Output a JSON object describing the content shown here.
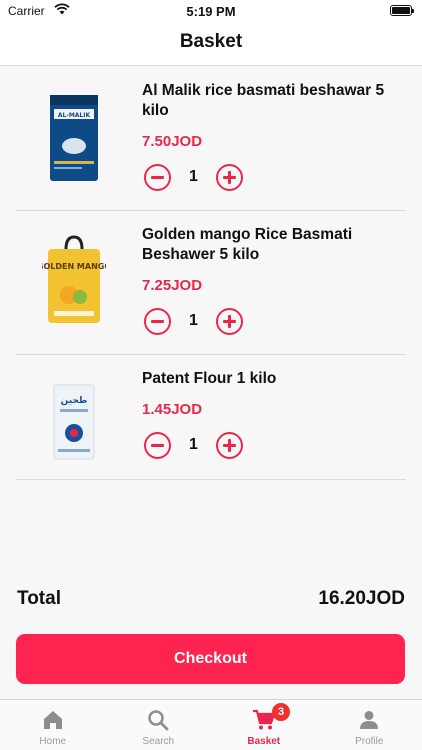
{
  "status_bar": {
    "carrier": "Carrier",
    "time": "5:19 PM"
  },
  "header": {
    "title": "Basket"
  },
  "items": [
    {
      "name": "Al Malik rice basmati beshawar 5 kilo",
      "price": "7.50JOD",
      "quantity": "1",
      "logo_text": "AL-MALIK"
    },
    {
      "name": "Golden mango Rice Basmati Beshawer 5 kilo",
      "price": "7.25JOD",
      "quantity": "1",
      "logo_text": "GOLDEN MANGO"
    },
    {
      "name": "Patent Flour 1 kilo",
      "price": "1.45JOD",
      "quantity": "1",
      "logo_text": "طحين"
    }
  ],
  "summary": {
    "total_label": "Total",
    "total_value": "16.20JOD"
  },
  "checkout_label": "Checkout",
  "tabs": [
    {
      "label": "Home",
      "icon": "home-icon"
    },
    {
      "label": "Search",
      "icon": "search-icon"
    },
    {
      "label": "Basket",
      "icon": "cart-icon",
      "badge": "3",
      "active": true
    },
    {
      "label": "Profile",
      "icon": "profile-icon"
    }
  ],
  "colors": {
    "accent": "#e8274b",
    "checkout": "#ff2450",
    "badge": "#f0312b"
  }
}
